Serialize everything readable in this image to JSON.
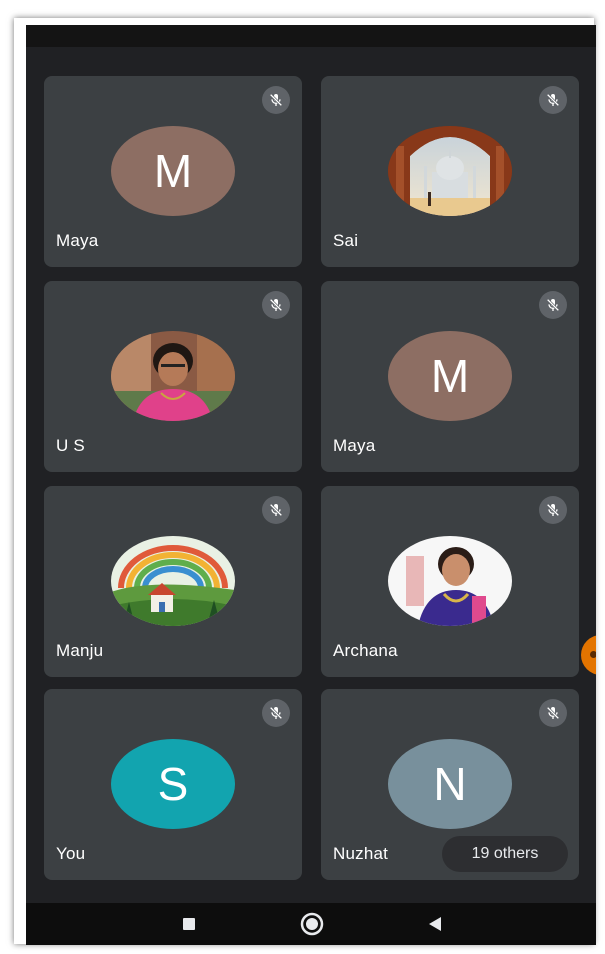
{
  "colors": {
    "screen_bg": "#202124",
    "tile_bg": "#3c4043",
    "mic_badge_bg": "#5f6368",
    "accent_orange": "#e37400"
  },
  "participants": [
    {
      "name": "Maya",
      "initial": "M",
      "avatar_color": "#8d6e63",
      "muted": true,
      "icon": "mic-off-icon"
    },
    {
      "name": "Sai",
      "initial": "",
      "avatar_image": "taj-mahal-photo",
      "muted": true,
      "icon": "mic-off-icon"
    },
    {
      "name": "U S",
      "initial": "",
      "avatar_image": "woman-portrait-photo",
      "muted": true,
      "icon": "mic-off-icon"
    },
    {
      "name": "Maya",
      "initial": "M",
      "avatar_color": "#8d6e63",
      "muted": true,
      "icon": "mic-off-icon"
    },
    {
      "name": "Manju",
      "initial": "",
      "avatar_image": "rainbow-house-illustration",
      "muted": true,
      "icon": "mic-off-icon"
    },
    {
      "name": "Archana",
      "initial": "",
      "avatar_image": "woman-saree-photo",
      "muted": true,
      "icon": "mic-off-icon"
    },
    {
      "name": "You",
      "initial": "S",
      "avatar_color": "#12a4af",
      "muted": true,
      "icon": "mic-off-icon"
    },
    {
      "name": "Nuzhat",
      "initial": "N",
      "avatar_color": "#78909c",
      "muted": true,
      "icon": "mic-off-icon"
    }
  ],
  "others_label": "19 others",
  "nav": {
    "recents_icon": "square-icon",
    "home_icon": "circle-icon",
    "back_icon": "triangle-back-icon"
  }
}
